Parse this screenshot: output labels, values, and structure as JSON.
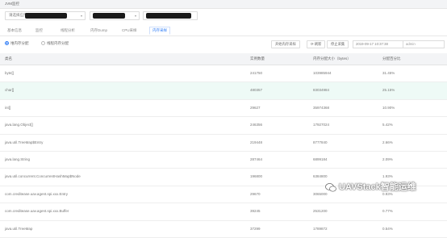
{
  "page": {
    "title": "JVM监控"
  },
  "selectors": {
    "app_label": "请选择应用实例",
    "caret": "▾"
  },
  "tabs": [
    {
      "label": "基本信息"
    },
    {
      "label": "监控"
    },
    {
      "label": "线程分析"
    },
    {
      "label": "内存Dump"
    },
    {
      "label": "CPU采样"
    },
    {
      "label": "内存采样",
      "active": true
    }
  ],
  "toolbar": {
    "radio_heap": "堆内存分配",
    "radio_thread": "线程内存分配",
    "start_button": "开始内存采样",
    "refresh_button": "刷新",
    "stop_button": "停止采集",
    "timestamp": "2019-09-17 10:37:38",
    "user": "admin"
  },
  "table": {
    "headers": [
      "类名",
      "实例数量",
      "内存分配大小（bytes）",
      "分配百分比"
    ],
    "rows": [
      [
        "byte[]",
        "241750",
        "103985944",
        "31.45%"
      ],
      [
        "char[]",
        "480357",
        "83034984",
        "25.15%"
      ],
      [
        "int[]",
        "29627",
        "35974368",
        "10.90%"
      ],
      [
        "java.lang.Object[]",
        "246356",
        "17927024",
        "5.42%"
      ],
      [
        "java.util.TreeMap$Entry",
        "219448",
        "8777840",
        "2.66%"
      ],
      [
        "java.lang.String",
        "287464",
        "6899184",
        "2.09%"
      ],
      [
        "java.util.concurrent.ConcurrentHashMap$Node",
        "196800",
        "6384800",
        "1.93%"
      ],
      [
        "com.creditease.uav.agent.spi.xxx.Entry",
        "29670",
        "3065000",
        "0.93%"
      ],
      [
        "com.creditease.uav.agent.spi.xxx.Buffer",
        "39245",
        "2531200",
        "0.77%"
      ],
      [
        "java.util.TreeMap",
        "37299",
        "1789872",
        "0.54%"
      ]
    ]
  },
  "watermark": {
    "text": "UAVStack智能运维"
  },
  "colors": {
    "accent": "#2f7df6",
    "highlight_row": "#eefaf6"
  }
}
